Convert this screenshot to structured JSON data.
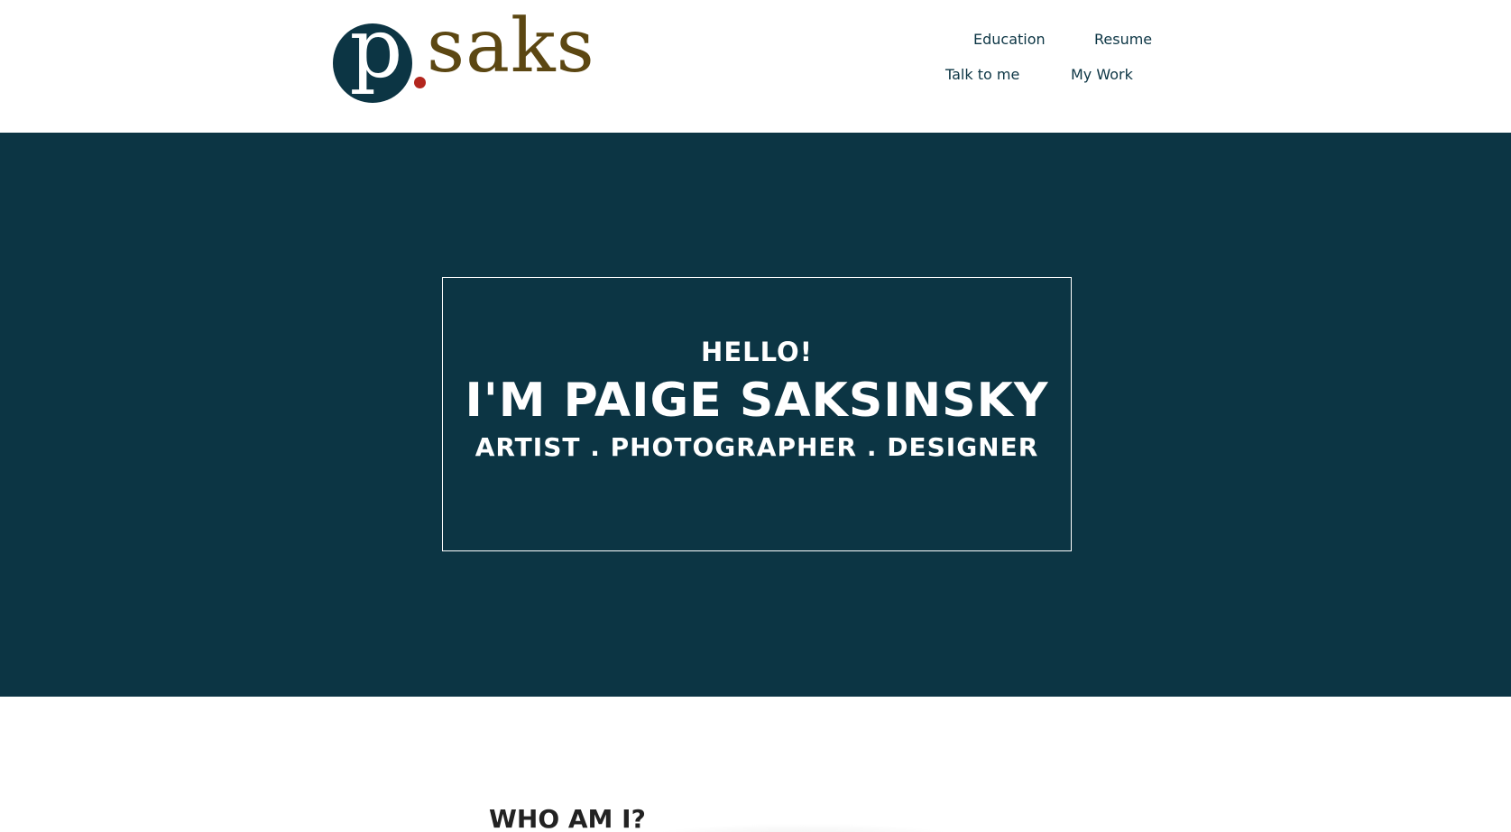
{
  "logo": {
    "letter": "p",
    "text": "saks",
    "colors": {
      "circle": "#0c3544",
      "dot": "#b3261e",
      "text": "#5c4712"
    }
  },
  "nav": {
    "education": "Education",
    "resume": "Resume",
    "talk": "Talk to me",
    "work": "My Work"
  },
  "hero": {
    "greeting": "HELLO!",
    "name": "I'M PAIGE SAKSINSKY",
    "roles": "ARTIST . PHOTOGRAPHER . DESIGNER",
    "background": "#0c3544"
  },
  "about": {
    "title": "WHO AM I?"
  }
}
